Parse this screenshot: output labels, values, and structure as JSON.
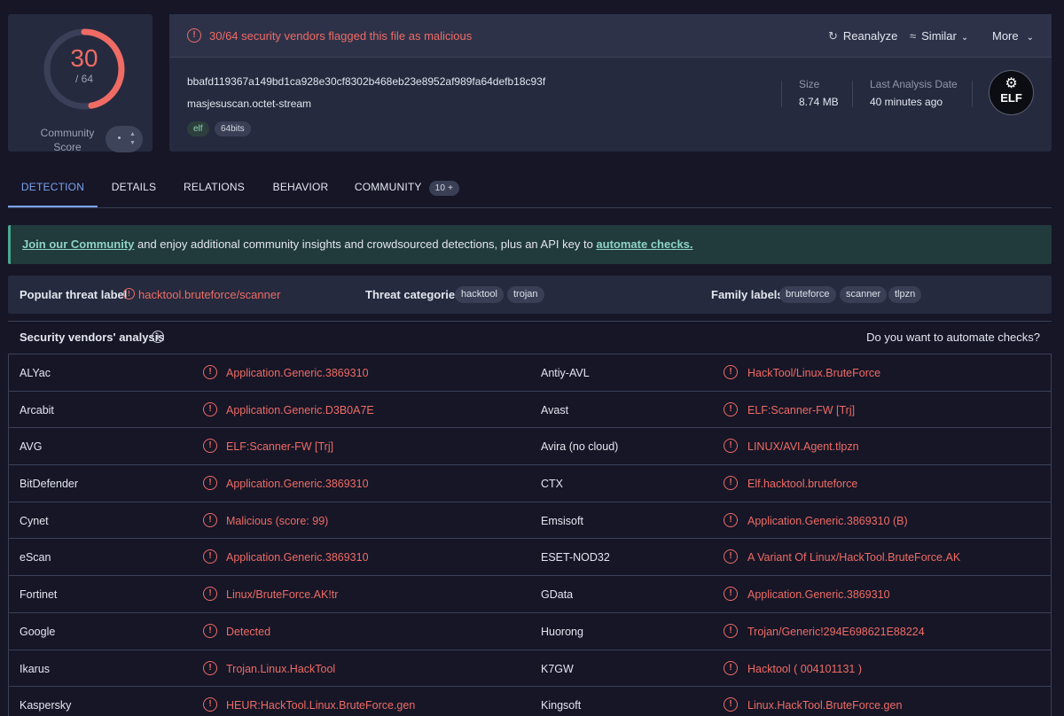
{
  "score": {
    "detected": "30",
    "total": "/ 64",
    "fraction": 0.469,
    "community_label_1": "Community",
    "community_label_2": "Score"
  },
  "alert": {
    "text": "30/64 security vendors flagged this file as malicious"
  },
  "actions": {
    "reanalyze": "Reanalyze",
    "similar": "Similar",
    "more": "More"
  },
  "file": {
    "hash": "bbafd119367a149bd1ca928e30cf8302b468eb23e8952af989fa64defb18c93f",
    "name": "masjesuscan.octet-stream",
    "tags": [
      "elf",
      "64bits"
    ],
    "size_label": "Size",
    "size_value": "8.74 MB",
    "date_label": "Last Analysis Date",
    "date_value": "40 minutes ago",
    "type_badge": "ELF"
  },
  "tabs": [
    {
      "label": "DETECTION",
      "active": true
    },
    {
      "label": "DETAILS"
    },
    {
      "label": "RELATIONS"
    },
    {
      "label": "BEHAVIOR"
    },
    {
      "label": "COMMUNITY",
      "badge": "10 +"
    }
  ],
  "banner": {
    "link1": "Join our Community",
    "middle": " and enjoy additional community insights and crowdsourced detections, plus an API key to ",
    "link2": "automate checks."
  },
  "threat": {
    "popular_label": "Popular threat label",
    "popular_value": "hacktool.bruteforce/scanner",
    "categories_label": "Threat categories",
    "categories": [
      "hacktool",
      "trojan"
    ],
    "family_label": "Family labels",
    "families": [
      "bruteforce",
      "scanner",
      "tlpzn"
    ]
  },
  "vendors_header": {
    "title": "Security vendors' analysis",
    "automate": "Do you want to automate checks?"
  },
  "vendors": [
    [
      "ALYac",
      "Application.Generic.3869310",
      "Antiy-AVL",
      "HackTool/Linux.BruteForce"
    ],
    [
      "Arcabit",
      "Application.Generic.D3B0A7E",
      "Avast",
      "ELF:Scanner-FW [Trj]"
    ],
    [
      "AVG",
      "ELF:Scanner-FW [Trj]",
      "Avira (no cloud)",
      "LINUX/AVI.Agent.tlpzn"
    ],
    [
      "BitDefender",
      "Application.Generic.3869310",
      "CTX",
      "Elf.hacktool.bruteforce"
    ],
    [
      "Cynet",
      "Malicious (score: 99)",
      "Emsisoft",
      "Application.Generic.3869310 (B)"
    ],
    [
      "eScan",
      "Application.Generic.3869310",
      "ESET-NOD32",
      "A Variant Of Linux/HackTool.BruteForce.AK"
    ],
    [
      "Fortinet",
      "Linux/BruteForce.AK!tr",
      "GData",
      "Application.Generic.3869310"
    ],
    [
      "Google",
      "Detected",
      "Huorong",
      "Trojan/Generic!294E698621E88224"
    ],
    [
      "Ikarus",
      "Trojan.Linux.HackTool",
      "K7GW",
      "Hacktool ( 004101131 )"
    ],
    [
      "Kaspersky",
      "HEUR:HackTool.Linux.BruteForce.gen",
      "Kingsoft",
      "Linux.HackTool.BruteForce.gen"
    ]
  ],
  "colors": {
    "malicious": "#ef6b64",
    "accent": "#7aa2f0",
    "background": "#161627",
    "card": "#252a3e"
  }
}
